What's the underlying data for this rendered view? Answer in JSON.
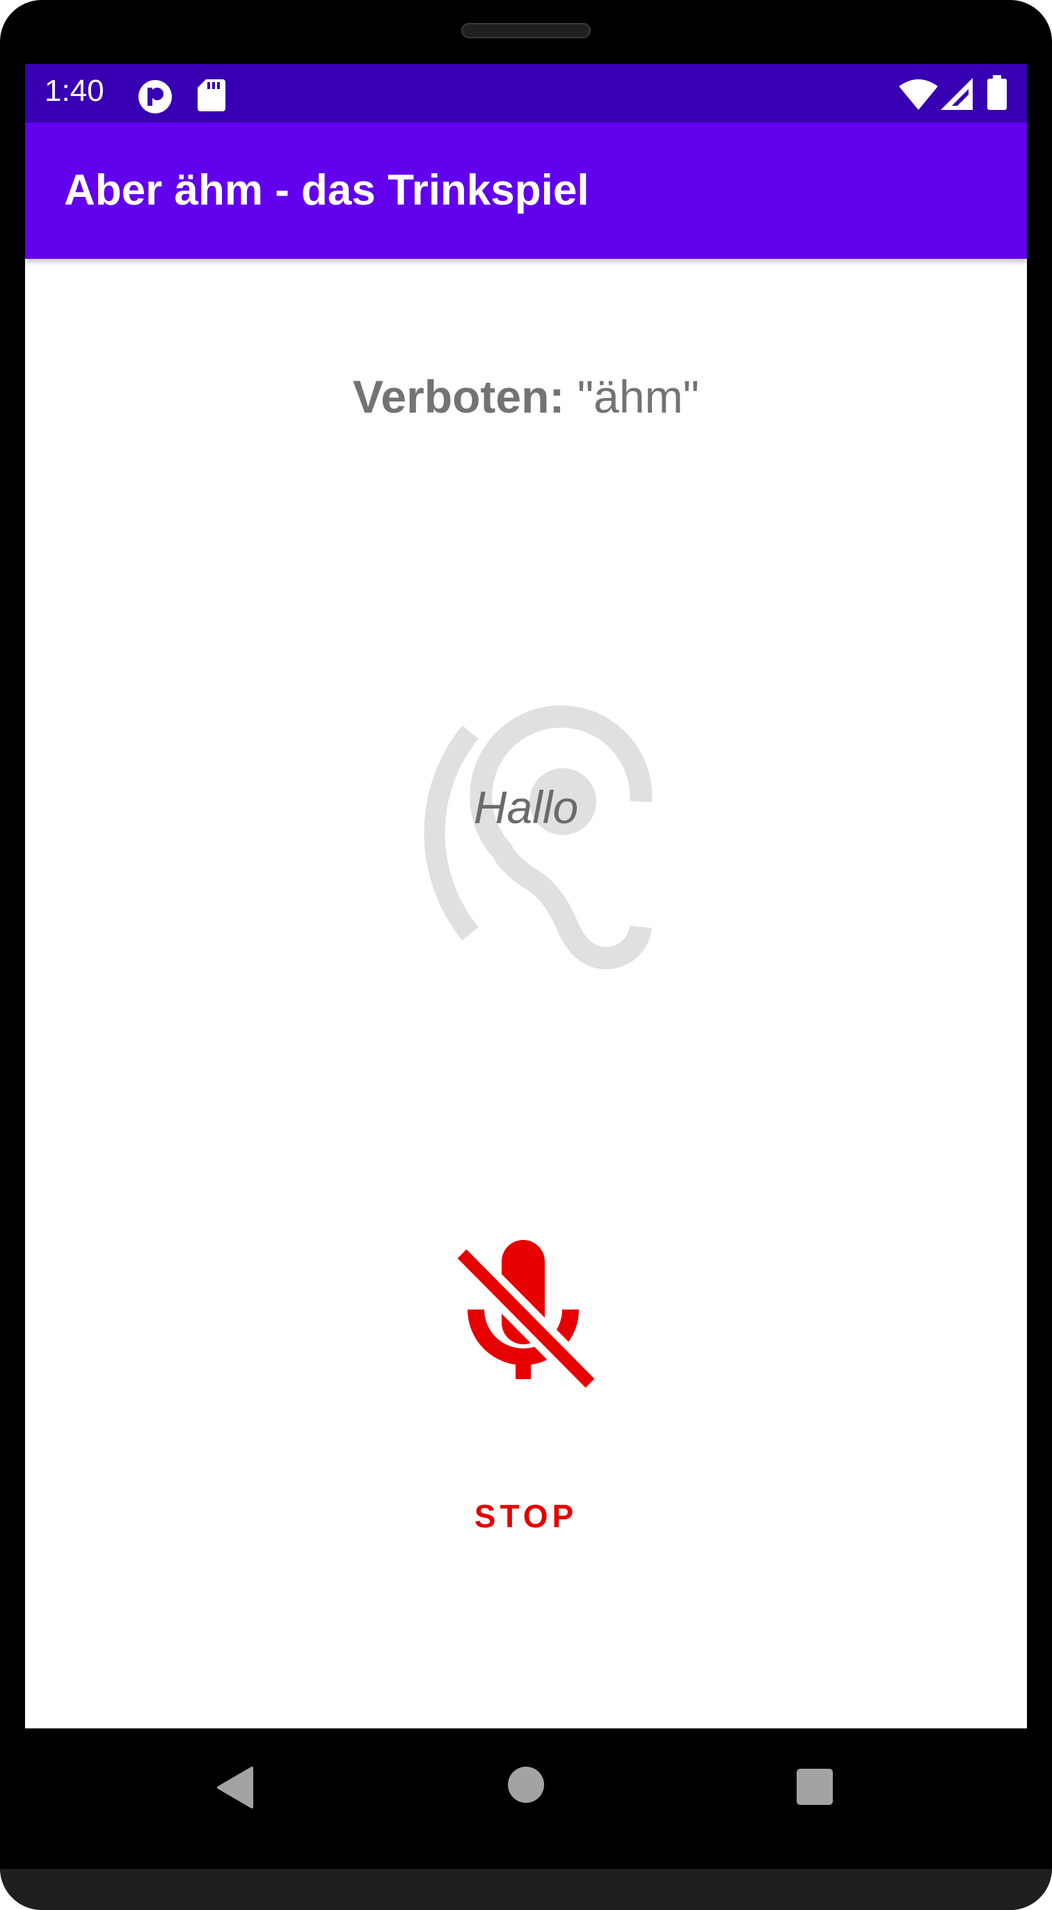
{
  "status_bar": {
    "time": "1:40",
    "icons": [
      "app-notification-icon",
      "sd-card-icon",
      "wifi-icon",
      "signal-icon",
      "battery-icon"
    ]
  },
  "app_bar": {
    "title": "Aber ähm - das Trinkspiel"
  },
  "main": {
    "forbidden_label": "Verboten:",
    "forbidden_word": " \"ähm\"",
    "heard_text": "Hallo",
    "ear_icon": "hearing-icon",
    "mic_icon": "mic-off-icon",
    "stop_label": "STOP"
  },
  "nav_bar": {
    "buttons": [
      "back-icon",
      "home-icon",
      "recents-icon"
    ]
  },
  "colors": {
    "status_bar": "#3700b3",
    "app_bar": "#6200ee",
    "accent_red": "#e60000",
    "ear_gray": "#e0e0e0",
    "text_gray": "#737373"
  }
}
